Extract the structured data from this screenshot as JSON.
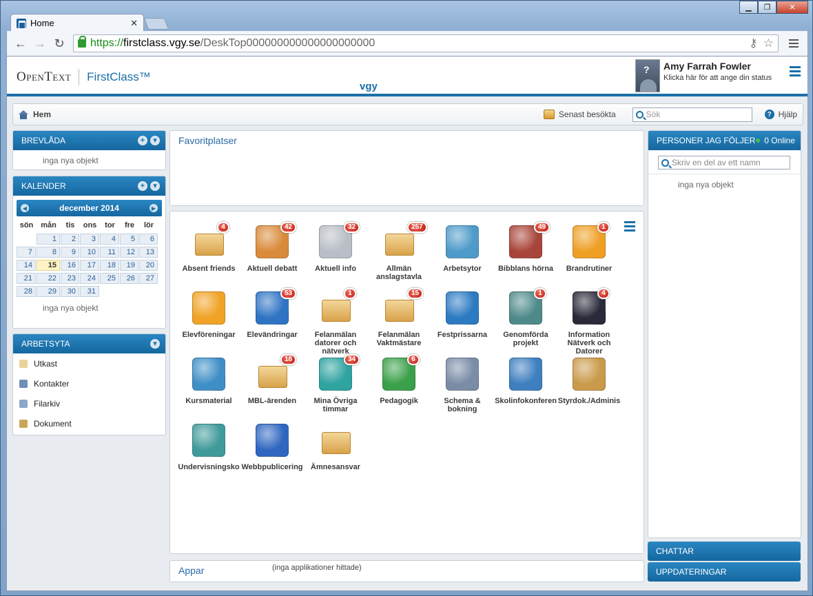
{
  "browser": {
    "tab_title": "Home",
    "tab_close": "✕",
    "url_scheme": "https://",
    "url_host": "firstclass.vgy.se",
    "url_path": "/DeskTop000000000000000000000",
    "key_icon": "⚷",
    "star_icon": "☆"
  },
  "header": {
    "brand_opentext": "OpenText",
    "brand_firstclass": "FirstClass™",
    "site_name": "vgy",
    "user_name": "Amy Farrah Fowler",
    "user_status": "Klicka här för att ange din status"
  },
  "crumbbar": {
    "home_label": "Hem",
    "recent_label": "Senast besökta",
    "search_placeholder": "Sök",
    "help_label": "Hjälp"
  },
  "mailbox": {
    "title": "BREVLÅDA",
    "empty": "inga nya objekt"
  },
  "calendar": {
    "title": "KALENDER",
    "month": "december 2014",
    "prev": "◀",
    "next": "▶",
    "dow": [
      "sön",
      "mån",
      "tis",
      "ons",
      "tor",
      "fre",
      "lör"
    ],
    "days": [
      "",
      "1",
      "2",
      "3",
      "4",
      "5",
      "6",
      "7",
      "8",
      "9",
      "10",
      "11",
      "12",
      "13",
      "14",
      "15",
      "16",
      "17",
      "18",
      "19",
      "20",
      "21",
      "22",
      "23",
      "24",
      "25",
      "26",
      "27",
      "28",
      "29",
      "30",
      "31"
    ],
    "today": "15",
    "empty": "inga nya objekt"
  },
  "workspace": {
    "title": "ARBETSYTA",
    "items": [
      {
        "label": "Utkast",
        "icon": "draft-icon",
        "color": "#e9d39a"
      },
      {
        "label": "Kontakter",
        "icon": "contacts-icon",
        "color": "#6f8fb8"
      },
      {
        "label": "Filarkiv",
        "icon": "file-archive-icon",
        "color": "#8aa7c9"
      },
      {
        "label": "Dokument",
        "icon": "document-icon",
        "color": "#c9a55a"
      }
    ]
  },
  "favorites": {
    "title": "Favoritplatser"
  },
  "desktop_icons": [
    {
      "label": "Absent friends",
      "badge": "4",
      "icon": "letter-folder-icon",
      "color": "#e8c27a"
    },
    {
      "label": "Aktuell debatt",
      "badge": "42",
      "icon": "house-phone-icon",
      "color": "#d98a3a"
    },
    {
      "label": "Aktuell info",
      "badge": "32",
      "icon": "newspaper-icon",
      "color": "#b9bec6"
    },
    {
      "label": "Allmän anslagstavla",
      "badge": "257",
      "icon": "board-folder-icon",
      "color": "#8d7bd1"
    },
    {
      "label": "Arbetsytor",
      "badge": "",
      "icon": "people-group-icon",
      "color": "#4e9ac9"
    },
    {
      "label": "Bibblans hörna",
      "badge": "49",
      "icon": "books-icon",
      "color": "#a8453a"
    },
    {
      "label": "Brandrutiner",
      "badge": "1",
      "icon": "hazard-icon",
      "color": "#ef9f24"
    },
    {
      "label": "Elevföreningar",
      "badge": "",
      "icon": "target-icon",
      "color": "#f0a326"
    },
    {
      "label": "Elevändringar",
      "badge": "53",
      "icon": "globe-hand-icon",
      "color": "#2f74c4"
    },
    {
      "label": "Felanmälan datorer och nätverk",
      "badge": "1",
      "icon": "check-folder-icon",
      "color": "#e5b86d"
    },
    {
      "label": "Felanmälan Vaktmästare",
      "badge": "15",
      "icon": "warning-folder-icon",
      "color": "#e5b86d"
    },
    {
      "label": "Festprissarna",
      "badge": "",
      "icon": "cutlery-icon",
      "color": "#2c7ac2"
    },
    {
      "label": "Genomförda projekt",
      "badge": "1",
      "icon": "thinker-icon",
      "color": "#4f8a8a"
    },
    {
      "label": "Information Nätverk och Datorer",
      "badge": "4",
      "icon": "plug-icon",
      "color": "#2a2a3a"
    },
    {
      "label": "Kursmaterial",
      "badge": "",
      "icon": "people-desk-icon",
      "color": "#3f8fc7"
    },
    {
      "label": "MBL-ärenden",
      "badge": "18",
      "icon": "people-folder-icon",
      "color": "#e5b86d"
    },
    {
      "label": "Mina Övriga timmar",
      "badge": "34",
      "icon": "check-monitor-icon",
      "color": "#2fa3a0"
    },
    {
      "label": "Pedagogik",
      "badge": "6",
      "icon": "apple-book-icon",
      "color": "#3aa04a"
    },
    {
      "label": "Schema & bokning",
      "badge": "",
      "icon": "alarm-clock-icon",
      "color": "#7a8ca6"
    },
    {
      "label": "Skolinfokonferen",
      "badge": "",
      "icon": "satellite-icon",
      "color": "#3e7fbf"
    },
    {
      "label": "Styrdok./Adminis",
      "badge": "",
      "icon": "magnifier-icon",
      "color": "#c99a4a"
    },
    {
      "label": "Undervisningsko",
      "badge": "",
      "icon": "graduation-cap-icon",
      "color": "#3f9a9a"
    },
    {
      "label": "Webbpublicering",
      "badge": "",
      "icon": "globe-arrows-icon",
      "color": "#2f67c0"
    },
    {
      "label": "Ämnesansvar",
      "badge": "",
      "icon": "cabinet-folder-icon",
      "color": "#e5b86d"
    }
  ],
  "apps": {
    "title": "Appar",
    "empty": "(inga applikationer hittade)"
  },
  "people": {
    "title": "PERSONER JAG FÖLJER",
    "online": "0 Online",
    "search_placeholder": "Skriv en del av ett namn",
    "empty": "inga nya objekt"
  },
  "bottom": {
    "chat": "CHATTAR",
    "updates": "UPPDATERINGAR"
  },
  "colors": {
    "accent": "#1a6fa8",
    "badge": "#c0180e"
  }
}
